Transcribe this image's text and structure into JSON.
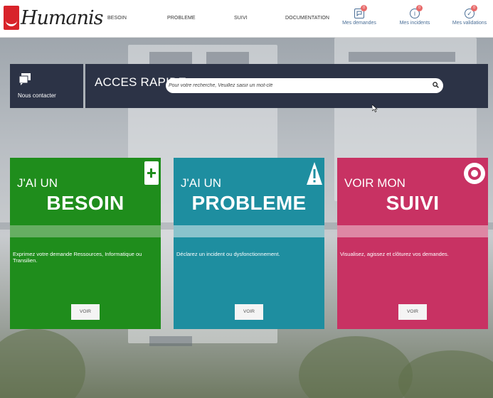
{
  "brand": {
    "name": "Humanis"
  },
  "nav": {
    "items": [
      {
        "label": "BESOIN"
      },
      {
        "label": "PROBLEME"
      },
      {
        "label": "SUIVI"
      },
      {
        "label": "DOCUMENTATION"
      }
    ]
  },
  "header_icons": [
    {
      "label": "Mes demandes",
      "badge": "0",
      "icon": "chat-icon"
    },
    {
      "label": "Mes incidents",
      "badge": "0",
      "icon": "info-icon"
    },
    {
      "label": "Mes validations",
      "badge": "0",
      "icon": "check-icon"
    }
  ],
  "contact": {
    "label": "Nous contacter",
    "icon": "chat-bubbles-icon"
  },
  "quick_access": {
    "title": "ACCES RAPIDE",
    "search_placeholder": "Pour votre recherche, Veuillez saisir un mot-clé",
    "search_value": ""
  },
  "cards": [
    {
      "pre": "J'AI UN",
      "title": "BESOIN",
      "description": "Exprimez votre demande Ressources, Informatique ou Transilien.",
      "button": "VOIR",
      "icon": "plus-icon",
      "color": "#1f8d1c"
    },
    {
      "pre": "J'AI UN",
      "title": "PROBLEME",
      "description": "Déclarez un incident ou dysfonctionnement.",
      "button": "VOIR",
      "icon": "warning-icon",
      "color": "#1e8ea0"
    },
    {
      "pre": "VOIR MON",
      "title": "SUIVI",
      "description": "Visualisez, agissez et clôturez vos demandes.",
      "button": "VOIR",
      "icon": "target-icon",
      "color": "#c83263"
    }
  ]
}
